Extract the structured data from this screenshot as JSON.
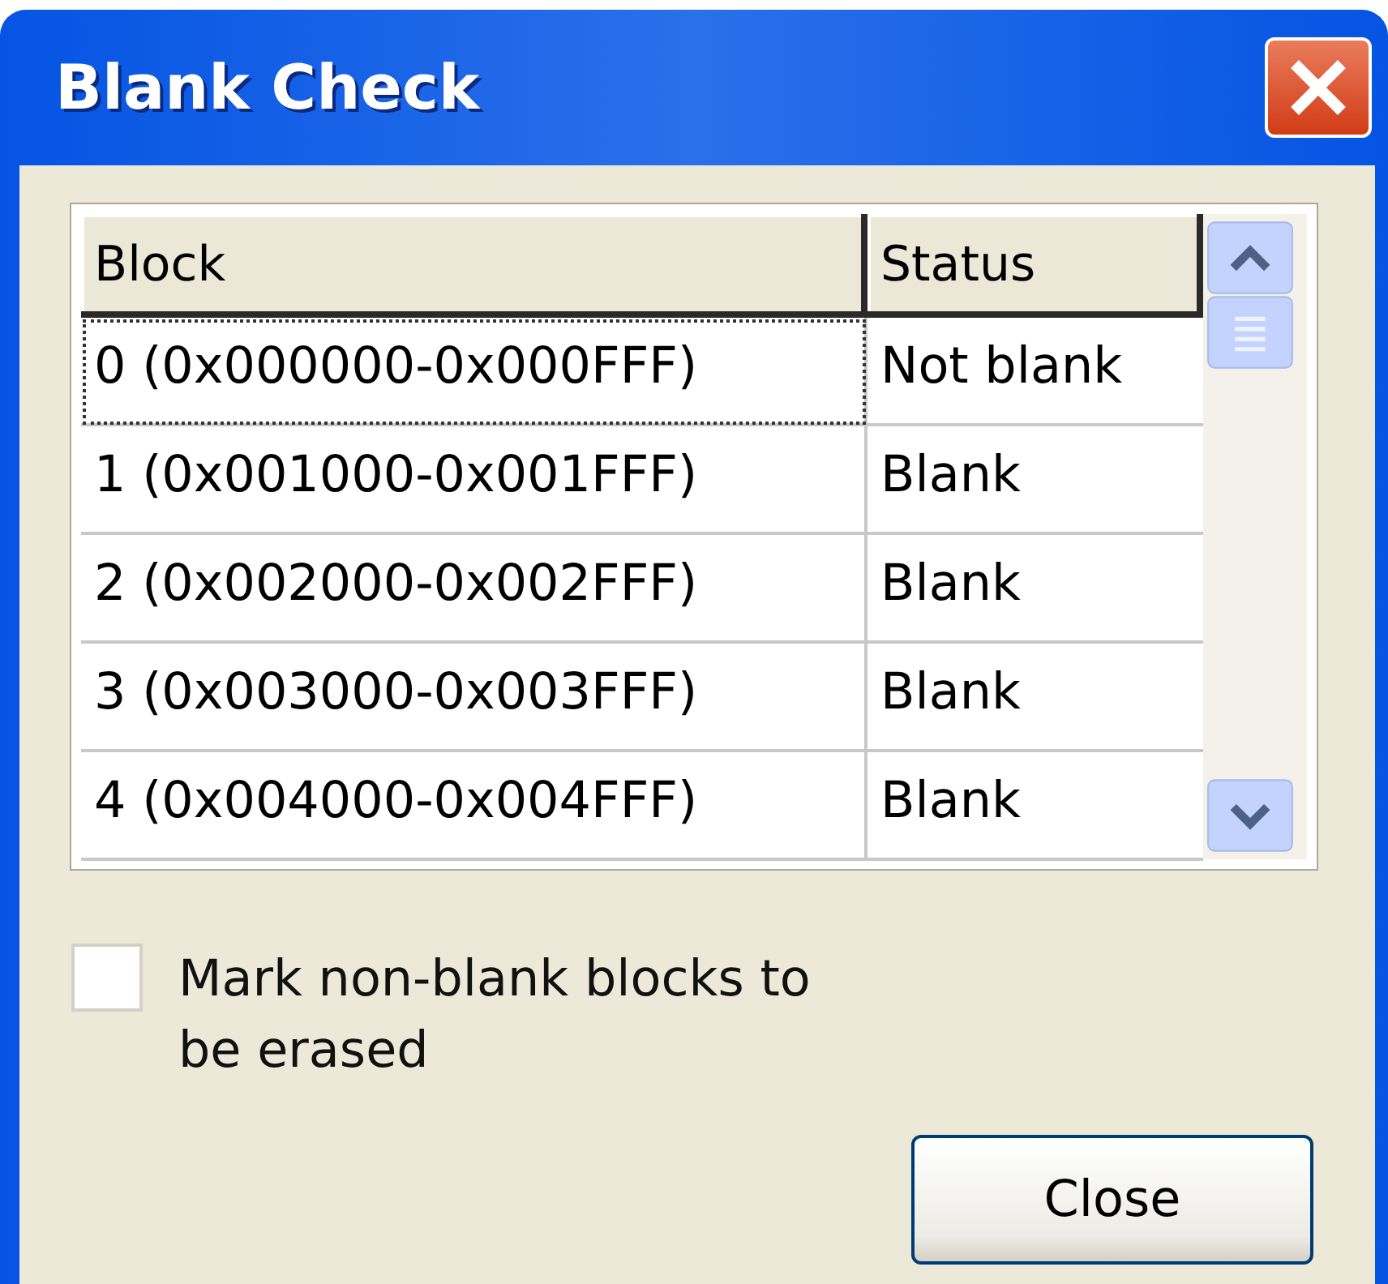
{
  "window": {
    "title": "Blank Check"
  },
  "table": {
    "columns": [
      "Block",
      "Status"
    ],
    "rows": [
      {
        "block": "0 (0x000000-0x000FFF)",
        "status": "Not blank",
        "focused": true
      },
      {
        "block": "1 (0x001000-0x001FFF)",
        "status": "Blank",
        "focused": false
      },
      {
        "block": "2 (0x002000-0x002FFF)",
        "status": "Blank",
        "focused": false
      },
      {
        "block": "3 (0x003000-0x003FFF)",
        "status": "Blank",
        "focused": false
      },
      {
        "block": "4 (0x004000-0x004FFF)",
        "status": "Blank",
        "focused": false
      }
    ]
  },
  "checkbox": {
    "label": "Mark non-blank blocks to be erased",
    "checked": false
  },
  "buttons": [
    "Close"
  ]
}
